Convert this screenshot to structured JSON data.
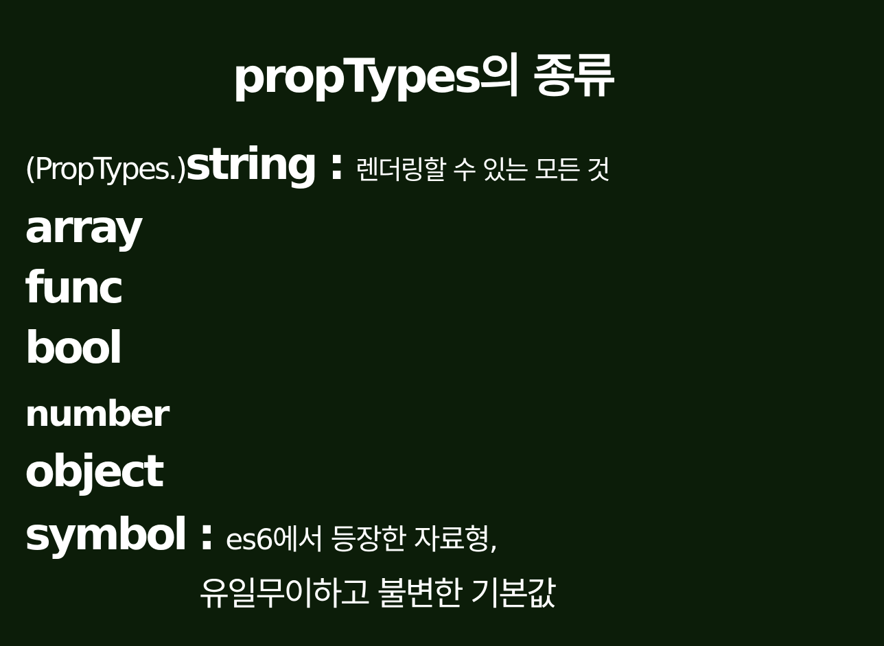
{
  "title": "propTypes의 종류",
  "types": {
    "string": {
      "prefix": "(PropTypes.)",
      "name": "string",
      "sep": " : ",
      "desc": "렌더링할 수 있는 모든 것"
    },
    "array": "array",
    "func": "func",
    "bool": "bool",
    "number": "number",
    "object": "object",
    "symbol": {
      "name": "symbol",
      "sep": " : ",
      "desc": "es6에서 등장한 자료형,",
      "desc2": "유일무이하고 불변한 기본값"
    }
  }
}
